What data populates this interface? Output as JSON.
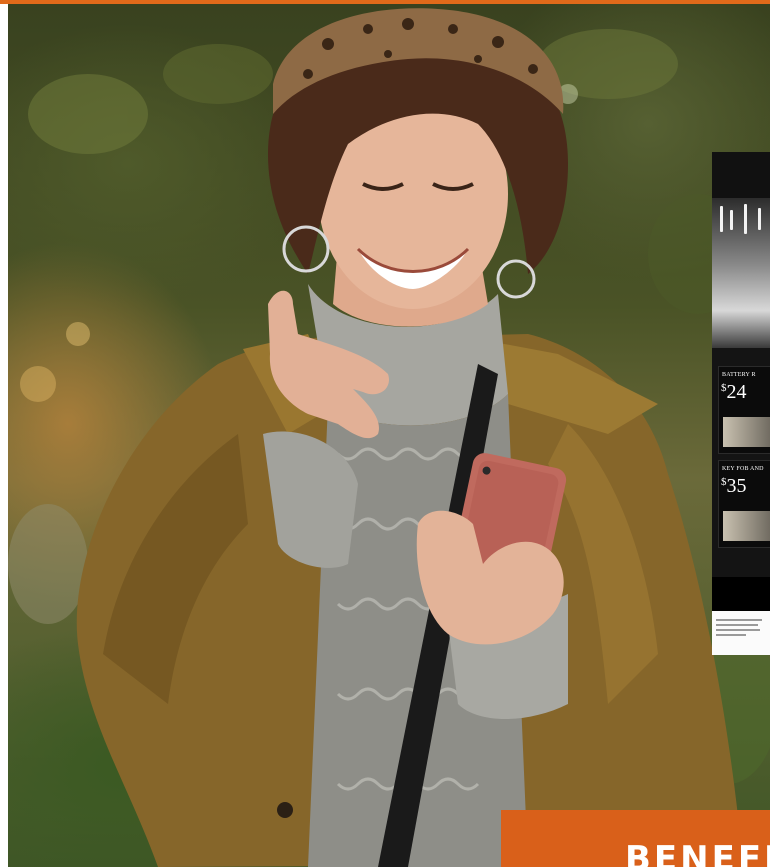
{
  "ad": {
    "offers": [
      {
        "label": "BATTERY R",
        "price_symbol": "$",
        "price": "24"
      },
      {
        "label": "KEY FOB AND",
        "price_symbol": "$",
        "price": "35"
      }
    ]
  },
  "banner": {
    "text": "BENEFI"
  },
  "colors": {
    "accent": "#d9601a",
    "jacket": "#8a6a24",
    "sweater": "#9c9c96"
  }
}
